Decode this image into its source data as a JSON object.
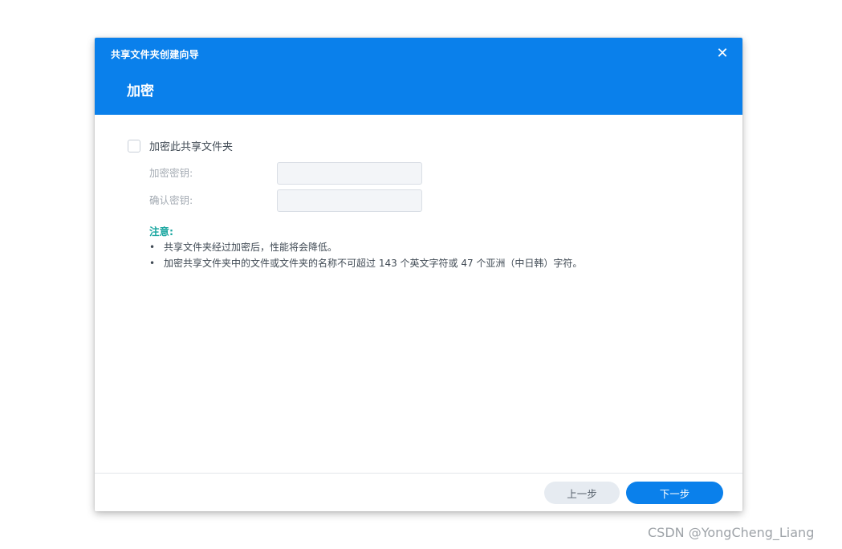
{
  "dialog": {
    "app_title": "共享文件夹创建向导",
    "close_icon": "close-icon",
    "close_glyph": "✕",
    "step_title": "加密"
  },
  "encryption": {
    "checkbox_label": "加密此共享文件夹",
    "checkbox_checked": false,
    "key_label": "加密密钥:",
    "key_value": "",
    "confirm_label": "确认密钥:",
    "confirm_value": ""
  },
  "notes": {
    "title": "注意:",
    "bullet_glyph": "•",
    "items": [
      "共享文件夹经过加密后，性能将会降低。",
      "加密共享文件夹中的文件或文件夹的名称不可超过 143 个英文字符或 47 个亚洲（中日韩）字符。"
    ]
  },
  "footer": {
    "prev_label": "上一步",
    "next_label": "下一步"
  },
  "watermark": "CSDN @YongCheng_Liang",
  "colors": {
    "accent": "#0a80eb",
    "note_title": "#19a6a0",
    "secondary_button": "#e6ebf1"
  }
}
